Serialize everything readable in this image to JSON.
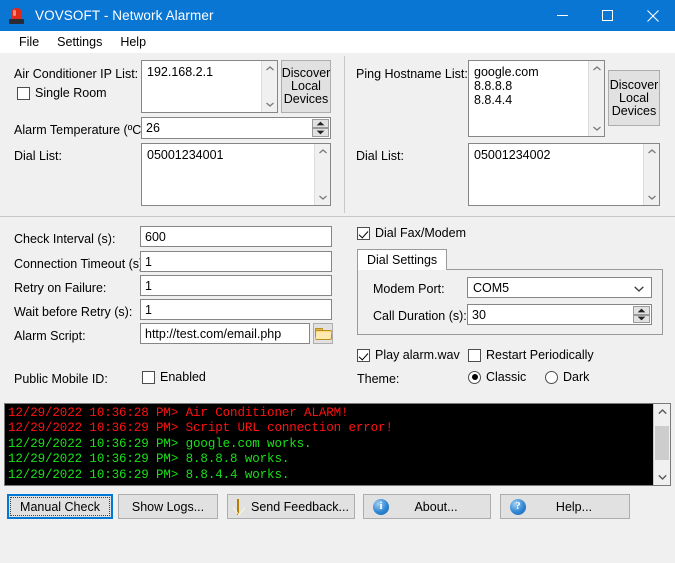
{
  "window": {
    "title": "VOVSOFT - Network Alarmer",
    "icon": "alarm-beacon-icon",
    "accent_color": "#0a76d4",
    "controls": {
      "minimize": "minimize-icon",
      "maximize": "maximize-icon",
      "close": "close-icon"
    }
  },
  "menu": {
    "items": [
      "File",
      "Settings",
      "Help"
    ]
  },
  "air_conditioner": {
    "ip_list_label": "Air Conditioner IP List:",
    "ip_list_value": "192.168.2.1",
    "single_room_label": "Single Room",
    "single_room_checked": false,
    "discover_label": "Discover\nLocal\nDevices",
    "alarm_temp_label": "Alarm Temperature (ºC):",
    "alarm_temp_value": "26",
    "dial_list_label": "Dial List:",
    "dial_list_value": "05001234001"
  },
  "ping": {
    "hostname_label": "Ping Hostname List:",
    "hostname_value": "google.com\n8.8.8.8\n8.8.4.4",
    "discover_label": "Discover\nLocal\nDevices",
    "dial_list_label": "Dial List:",
    "dial_list_value": "05001234002"
  },
  "settings": {
    "check_interval_label": "Check Interval (s):",
    "check_interval_value": "600",
    "connection_timeout_label": "Connection Timeout (s):",
    "connection_timeout_value": "1",
    "retry_on_failure_label": "Retry on Failure:",
    "retry_on_failure_value": "1",
    "wait_before_retry_label": "Wait before Retry (s):",
    "wait_before_retry_value": "1",
    "alarm_script_label": "Alarm Script:",
    "alarm_script_value": "http://test.com/email.php",
    "browse_icon": "folder-icon",
    "public_mobile_label": "Public Mobile ID:",
    "public_mobile_enabled_label": "Enabled",
    "public_mobile_enabled_checked": false
  },
  "dial": {
    "fax_modem_label": "Dial Fax/Modem",
    "fax_modem_checked": true,
    "tab_label": "Dial Settings",
    "modem_port_label": "Modem Port:",
    "modem_port_value": "COM5",
    "call_duration_label": "Call Duration (s):",
    "call_duration_value": "30"
  },
  "options": {
    "play_wav_label": "Play alarm.wav",
    "play_wav_checked": true,
    "restart_label": "Restart Periodically",
    "restart_checked": false,
    "theme_label": "Theme:",
    "theme_classic_label": "Classic",
    "theme_dark_label": "Dark",
    "theme_selected": "Classic"
  },
  "console": {
    "alarm_color": "#ff1111",
    "ok_color": "#18e018",
    "background": "#000000",
    "lines": [
      {
        "timestamp": "12/29/2022 10:36:28 PM>",
        "message": "Air Conditioner ALARM!",
        "level": "alarm"
      },
      {
        "timestamp": "12/29/2022 10:36:29 PM>",
        "message": "Script URL connection error!",
        "level": "alarm"
      },
      {
        "timestamp": "12/29/2022 10:36:29 PM>",
        "message": "google.com works.",
        "level": "ok"
      },
      {
        "timestamp": "12/29/2022 10:36:29 PM>",
        "message": "8.8.8.8 works.",
        "level": "ok"
      },
      {
        "timestamp": "12/29/2022 10:36:29 PM>",
        "message": "8.8.4.4 works.",
        "level": "ok"
      }
    ]
  },
  "buttons": {
    "manual_check": "Manual Check",
    "show_logs": "Show Logs...",
    "send_feedback": "Send Feedback...",
    "about": "About...",
    "help": "Help...",
    "feedback_icon": "envelope-icon",
    "about_icon": "info-circle-icon",
    "help_icon": "question-circle-icon"
  }
}
